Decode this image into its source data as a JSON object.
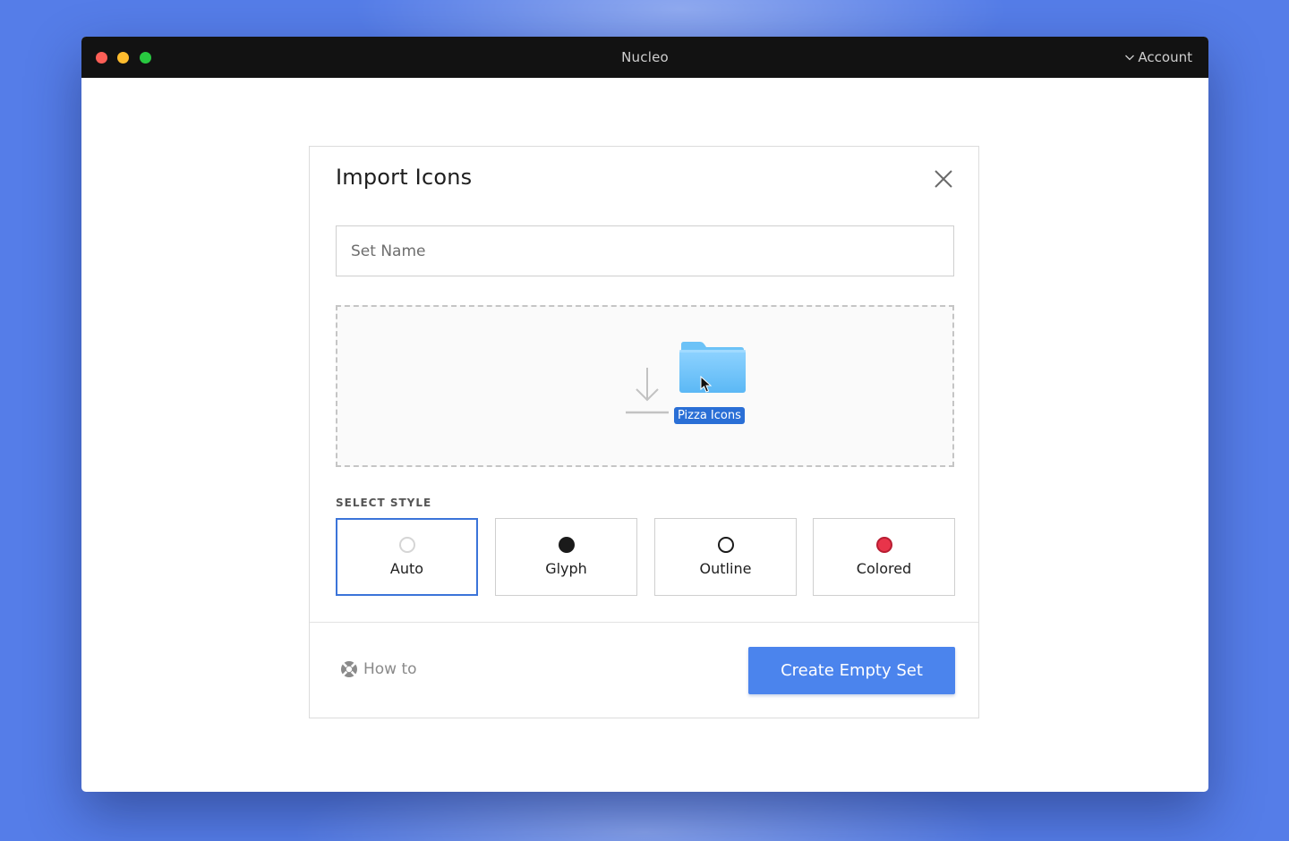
{
  "window": {
    "title": "Nucleo",
    "account_label": "Account"
  },
  "modal": {
    "title": "Import Icons",
    "set_name_placeholder": "Set Name",
    "set_name_value": "",
    "dropzone": {
      "folder_label": "Pizza Icons",
      "icons": [
        "download-icon",
        "folder-icon",
        "cursor-icon"
      ]
    },
    "style_section_label": "SELECT STYLE",
    "styles": [
      {
        "label": "Auto",
        "selected": true
      },
      {
        "label": "Glyph",
        "selected": false
      },
      {
        "label": "Outline",
        "selected": false
      },
      {
        "label": "Colored",
        "selected": false
      }
    ],
    "howto_label": "How to",
    "create_button_label": "Create Empty Set"
  },
  "colors": {
    "desktop_bg": "#557de8",
    "titlebar": "#121212",
    "accent": "#4b84ed",
    "selected_border": "#3b74d9",
    "colored_dot": "#e8344a",
    "folder_label_bg": "#2a6fd6"
  }
}
